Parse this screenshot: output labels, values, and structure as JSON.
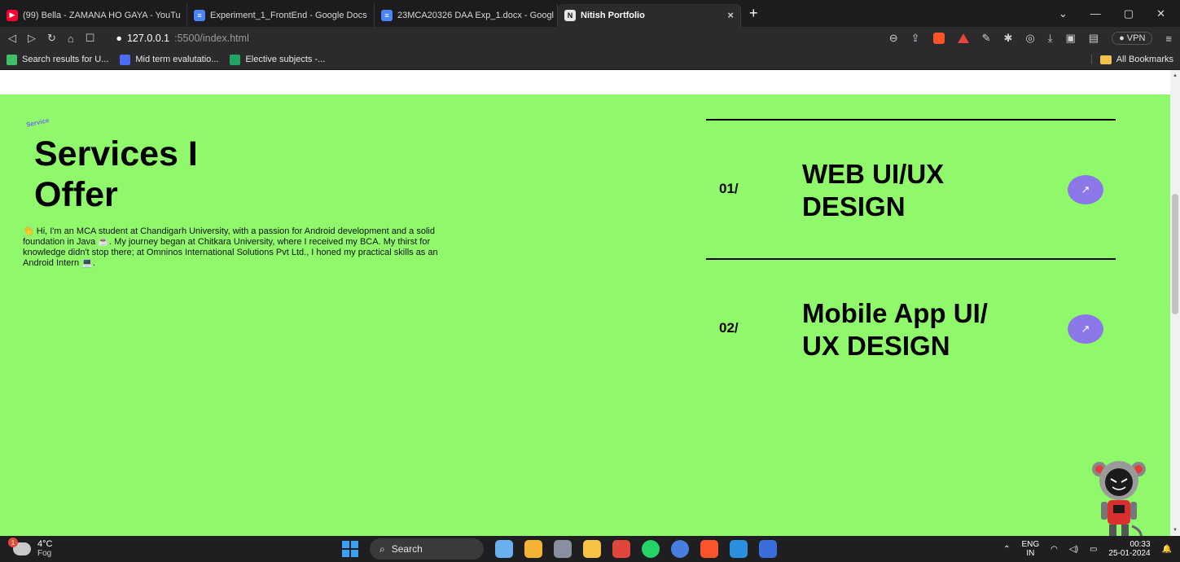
{
  "browser": {
    "tabs": [
      {
        "label": "(99) Bella - ZAMANA HO GAYA - YouTu",
        "icon": "youtube-icon"
      },
      {
        "label": "Experiment_1_FrontEnd - Google Docs",
        "icon": "google-docs-icon"
      },
      {
        "label": "23MCA20326 DAA Exp_1.docx - Googl",
        "icon": "google-docs-icon"
      },
      {
        "label": "Nitish Portfolio",
        "icon": "portfolio-icon"
      }
    ],
    "close_tab": "×",
    "new_tab": "+",
    "url_host": "127.0.0.1",
    "url_path": ":5500/index.html",
    "vpn_label": "VPN",
    "bookmarks": [
      {
        "label": "Search results for U...",
        "color": "#3fbf6a"
      },
      {
        "label": "Mid term evalutatio...",
        "color": "#4a6cf7"
      },
      {
        "label": "Elective subjects -...",
        "color": "#21a464"
      }
    ],
    "all_bookmarks": "All Bookmarks"
  },
  "page": {
    "section_tag": "Service",
    "title": "Services I Offer",
    "description": "👋 Hi, I'm an MCA student at Chandigarh University, with a passion for Android development and a solid foundation in Java ☕. My journey began at Chitkara University, where I received my BCA. My thirst for knowledge didn't stop there; at Omninos International Solutions Pvt Ltd., I honed my practical skills as an Android Intern 💻.",
    "services": [
      {
        "number": "01/",
        "name": "WEB UI/UX DESIGN",
        "arrow": "↗"
      },
      {
        "number": "02/",
        "name": "Mobile App UI/ UX DESIGN",
        "arrow": "↗"
      }
    ],
    "accent_color": "#90f96b",
    "button_color": "#8b77e8"
  },
  "taskbar": {
    "weather_temp": "4°C",
    "weather_desc": "Fog",
    "weather_badge": "1",
    "search_label": "Search",
    "lang_top": "ENG",
    "lang_bottom": "IN",
    "time": "00:33",
    "date": "25-01-2024"
  }
}
